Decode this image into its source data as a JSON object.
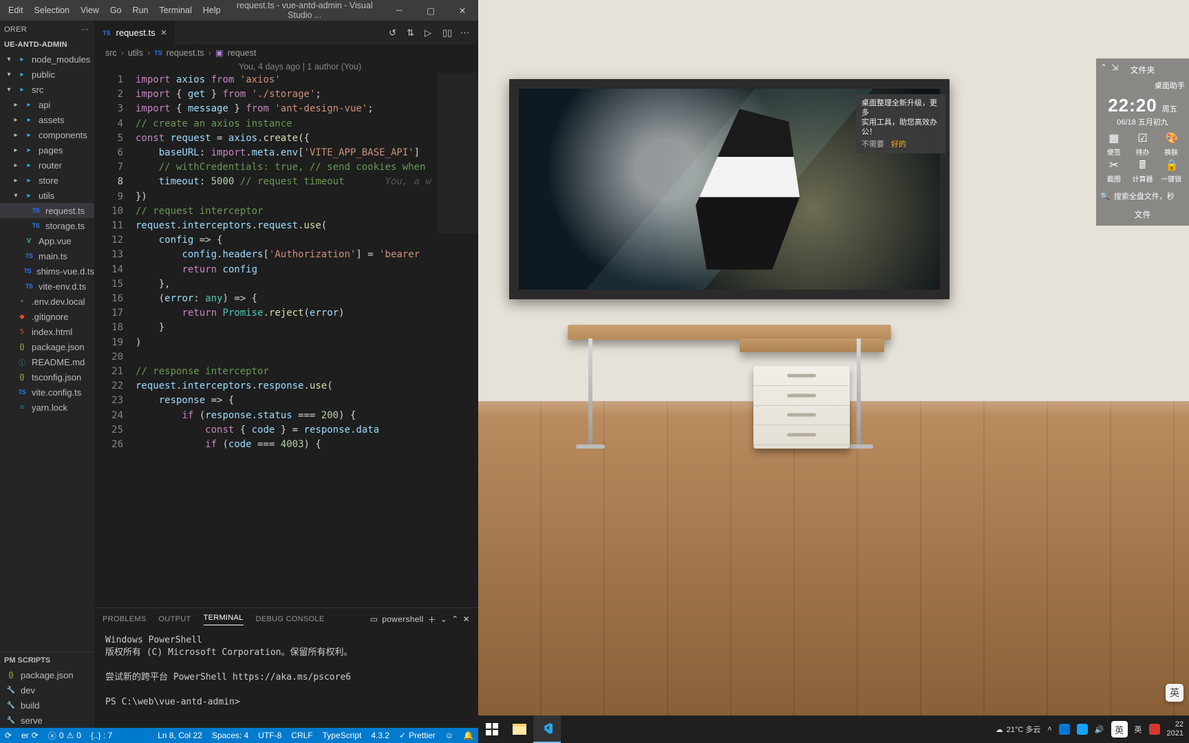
{
  "menu": [
    "Edit",
    "Selection",
    "View",
    "Go",
    "Run",
    "Terminal",
    "Help"
  ],
  "window_title": "request.ts - vue-antd-admin - Visual Studio ...",
  "explorer": {
    "title": "ORER",
    "project": "UE-ANTD-ADMIN",
    "tree": [
      {
        "d": 1,
        "t": "folder",
        "open": true,
        "l": "node_modules"
      },
      {
        "d": 1,
        "t": "folder",
        "open": true,
        "l": "public"
      },
      {
        "d": 1,
        "t": "folder",
        "open": true,
        "l": "src"
      },
      {
        "d": 2,
        "t": "folder",
        "open": false,
        "l": "api"
      },
      {
        "d": 2,
        "t": "folder",
        "open": false,
        "l": "assets"
      },
      {
        "d": 2,
        "t": "folder",
        "open": false,
        "l": "components"
      },
      {
        "d": 2,
        "t": "folder",
        "open": false,
        "l": "pages"
      },
      {
        "d": 2,
        "t": "folder",
        "open": false,
        "l": "router"
      },
      {
        "d": 2,
        "t": "folder",
        "open": false,
        "l": "store"
      },
      {
        "d": 2,
        "t": "folder",
        "open": true,
        "l": "utils"
      },
      {
        "d": 3,
        "t": "ts",
        "l": "request.ts",
        "sel": true
      },
      {
        "d": 3,
        "t": "ts",
        "l": "storage.ts"
      },
      {
        "d": 2,
        "t": "vue",
        "l": "App.vue"
      },
      {
        "d": 2,
        "t": "ts",
        "l": "main.ts"
      },
      {
        "d": 2,
        "t": "ts",
        "l": "shims-vue.d.ts"
      },
      {
        "d": 2,
        "t": "ts",
        "l": "vite-env.d.ts"
      },
      {
        "d": 1,
        "t": "file",
        "l": ".env.dev.local"
      },
      {
        "d": 1,
        "t": "git",
        "l": ".gitignore"
      },
      {
        "d": 1,
        "t": "html",
        "l": "index.html"
      },
      {
        "d": 1,
        "t": "json",
        "l": "package.json"
      },
      {
        "d": 1,
        "t": "md",
        "l": "README.md"
      },
      {
        "d": 1,
        "t": "json",
        "l": "tsconfig.json"
      },
      {
        "d": 1,
        "t": "ts",
        "l": "vite.config.ts"
      },
      {
        "d": 1,
        "t": "yarn",
        "l": "yarn.lock"
      }
    ],
    "npm_title": "PM SCRIPTS",
    "scripts": [
      {
        "i": "json",
        "l": "package.json"
      },
      {
        "i": "wrench",
        "l": "dev"
      },
      {
        "i": "wrench",
        "l": "build"
      },
      {
        "i": "wrench",
        "l": "serve"
      }
    ]
  },
  "tab": {
    "icon": "TS",
    "name": "request.ts"
  },
  "breadcrumb": [
    "src",
    "utils",
    "request.ts",
    "request"
  ],
  "authorline": "You, 4 days ago | 1 author (You)",
  "code_lines": [
    "<span class='kw'>import</span> <span class='id'>axios</span> <span class='kw'>from</span> <span class='str'>'axios'</span>",
    "<span class='kw'>import</span> <span class='pu'>{</span> <span class='id'>get</span> <span class='pu'>}</span> <span class='kw'>from</span> <span class='str'>'./storage'</span><span class='pu'>;</span>",
    "<span class='kw'>import</span> <span class='pu'>{</span> <span class='id'>message</span> <span class='pu'>}</span> <span class='kw'>from</span> <span class='str'>'ant-design-vue'</span><span class='pu'>;</span>",
    "<span class='cmt'>// create an axios instance</span>",
    "<span class='kw'>const</span> <span class='id'>request</span> <span class='op'>=</span> <span class='id'>axios</span><span class='pu'>.</span><span class='fn'>create</span><span class='pu'>({</span>",
    "    <span class='pr'>baseURL</span><span class='pu'>:</span> <span class='kw'>import</span><span class='pu'>.</span><span class='id'>meta</span><span class='pu'>.</span><span class='id'>env</span><span class='pu'>[</span><span class='str'>'VITE_APP_BASE_API'</span><span class='pu'>]</span>",
    "    <span class='cmt'>// withCredentials: true, // send cookies when</span>",
    "    <span class='pr'>timeout</span><span class='pu'>:</span> <span class='num'>5000</span> <span class='cmt'>// request timeout</span>       <span class='lens'>You, a w</span>",
    "<span class='pu'>})</span>",
    "<span class='cmt'>// request interceptor</span>",
    "<span class='id'>request</span><span class='pu'>.</span><span class='id'>interceptors</span><span class='pu'>.</span><span class='id'>request</span><span class='pu'>.</span><span class='fn'>use</span><span class='pu'>(</span>",
    "    <span class='id'>config</span> <span class='op'>=&gt;</span> <span class='pu'>{</span>",
    "        <span class='id'>config</span><span class='pu'>.</span><span class='id'>headers</span><span class='pu'>[</span><span class='str'>'Authorization'</span><span class='pu'>]</span> <span class='op'>=</span> <span class='str'>'bearer</span>",
    "        <span class='kw'>return</span> <span class='id'>config</span>",
    "    <span class='pu'>},</span>",
    "    <span class='pu'>(</span><span class='id'>error</span><span class='pu'>:</span> <span class='ty'>any</span><span class='pu'>)</span> <span class='op'>=&gt;</span> <span class='pu'>{</span>",
    "        <span class='kw'>return</span> <span class='ty'>Promise</span><span class='pu'>.</span><span class='fn'>reject</span><span class='pu'>(</span><span class='id'>error</span><span class='pu'>)</span>",
    "    <span class='pu'>}</span>",
    "<span class='pu'>)</span>",
    "",
    "<span class='cmt'>// response interceptor</span>",
    "<span class='id'>request</span><span class='pu'>.</span><span class='id'>interceptors</span><span class='pu'>.</span><span class='id'>response</span><span class='pu'>.</span><span class='fn'>use</span><span class='pu'>(</span>",
    "    <span class='id'>response</span> <span class='op'>=&gt;</span> <span class='pu'>{</span>",
    "        <span class='kw'>if</span> <span class='pu'>(</span><span class='id'>response</span><span class='pu'>.</span><span class='id'>status</span> <span class='op'>===</span> <span class='num'>200</span><span class='pu'>)</span> <span class='pu'>{</span>",
    "            <span class='kw'>const</span> <span class='pu'>{</span> <span class='id'>code</span> <span class='pu'>}</span> <span class='op'>=</span> <span class='id'>response</span><span class='pu'>.</span><span class='id'>data</span>",
    "            <span class='kw'>if</span> <span class='pu'>(</span><span class='id'>code</span> <span class='op'>===</span> <span class='num'>4003</span><span class='pu'>)</span> <span class='pu'>{</span>"
  ],
  "panel": {
    "tabs": [
      "PROBLEMS",
      "OUTPUT",
      "TERMINAL",
      "DEBUG CONSOLE"
    ],
    "active": 2,
    "shell": "powershell",
    "lines": [
      "Windows PowerShell",
      "版权所有 (C) Microsoft Corporation。保留所有权利。",
      "",
      "尝试新的跨平台 PowerShell https://aka.ms/pscore6",
      "",
      "PS C:\\web\\vue-antd-admin>"
    ]
  },
  "status": {
    "branch": "er",
    "errors": "0",
    "warnings": "0",
    "braces": "{..} : 7",
    "pos": "Ln 8, Col 22",
    "spaces": "Spaces: 4",
    "enc": "UTF-8",
    "eol": "CRLF",
    "lang": "TypeScript",
    "tsver": "4.3.2",
    "prettier": "Prettier"
  },
  "desktop": {
    "widget": {
      "folder": "文件夹",
      "helper": "桌面助手",
      "popup_l1": "桌面整理全新升级，更多",
      "popup_l2": "实用工具，助您高效办公！",
      "popup_no": "不需要",
      "popup_ok": "好的",
      "time": "22:20",
      "weekday": "周五",
      "date": "06/18 五月初九",
      "cells": [
        "便签",
        "待办",
        "换肤",
        "截图",
        "计算器",
        "一键锁"
      ],
      "search": "搜索全盘文件，秒",
      "file": "文件"
    },
    "taskbar": {
      "weather": "21°C 多云",
      "ime": "英",
      "ime2": "英",
      "time": "22",
      "date": "2021"
    },
    "imebadge": "英"
  }
}
